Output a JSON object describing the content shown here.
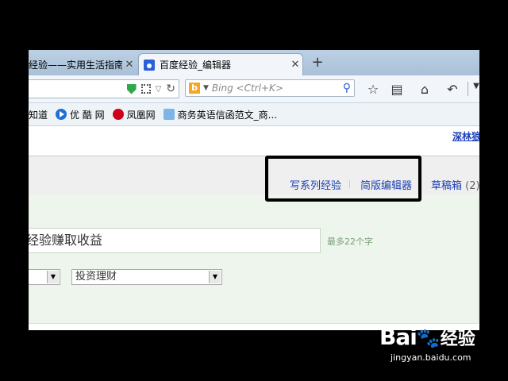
{
  "browser": {
    "tabs": [
      {
        "label": "经验——实用生活指南",
        "active": false
      },
      {
        "label": "百度经验_编辑器",
        "active": true
      }
    ],
    "new_tab": "+",
    "close": "✕",
    "search": {
      "placeholder": "Bing <Ctrl+K>"
    },
    "bookmarks": [
      {
        "label": "知道",
        "icon": "baidu-zhidao-icon"
      },
      {
        "label": "优 酷 网",
        "icon": "youku-icon"
      },
      {
        "label": "凤凰网",
        "icon": "ifeng-icon"
      },
      {
        "label": "商务英语信函范文_商...",
        "icon": "en-icon"
      }
    ]
  },
  "page": {
    "top_link": "深林狼神",
    "tabs": {
      "series": "写系列经验",
      "simple_editor": "简版编辑器",
      "drafts": "草稿箱",
      "drafts_count": "(2)"
    },
    "title_input": {
      "value": "经验赚取收益"
    },
    "title_hint": "最多22个字",
    "category_select": {
      "value": "投资理财"
    }
  },
  "watermark": {
    "logo": "Bai",
    "logo_cn": "经验",
    "url": "jingyan.baidu.com"
  }
}
